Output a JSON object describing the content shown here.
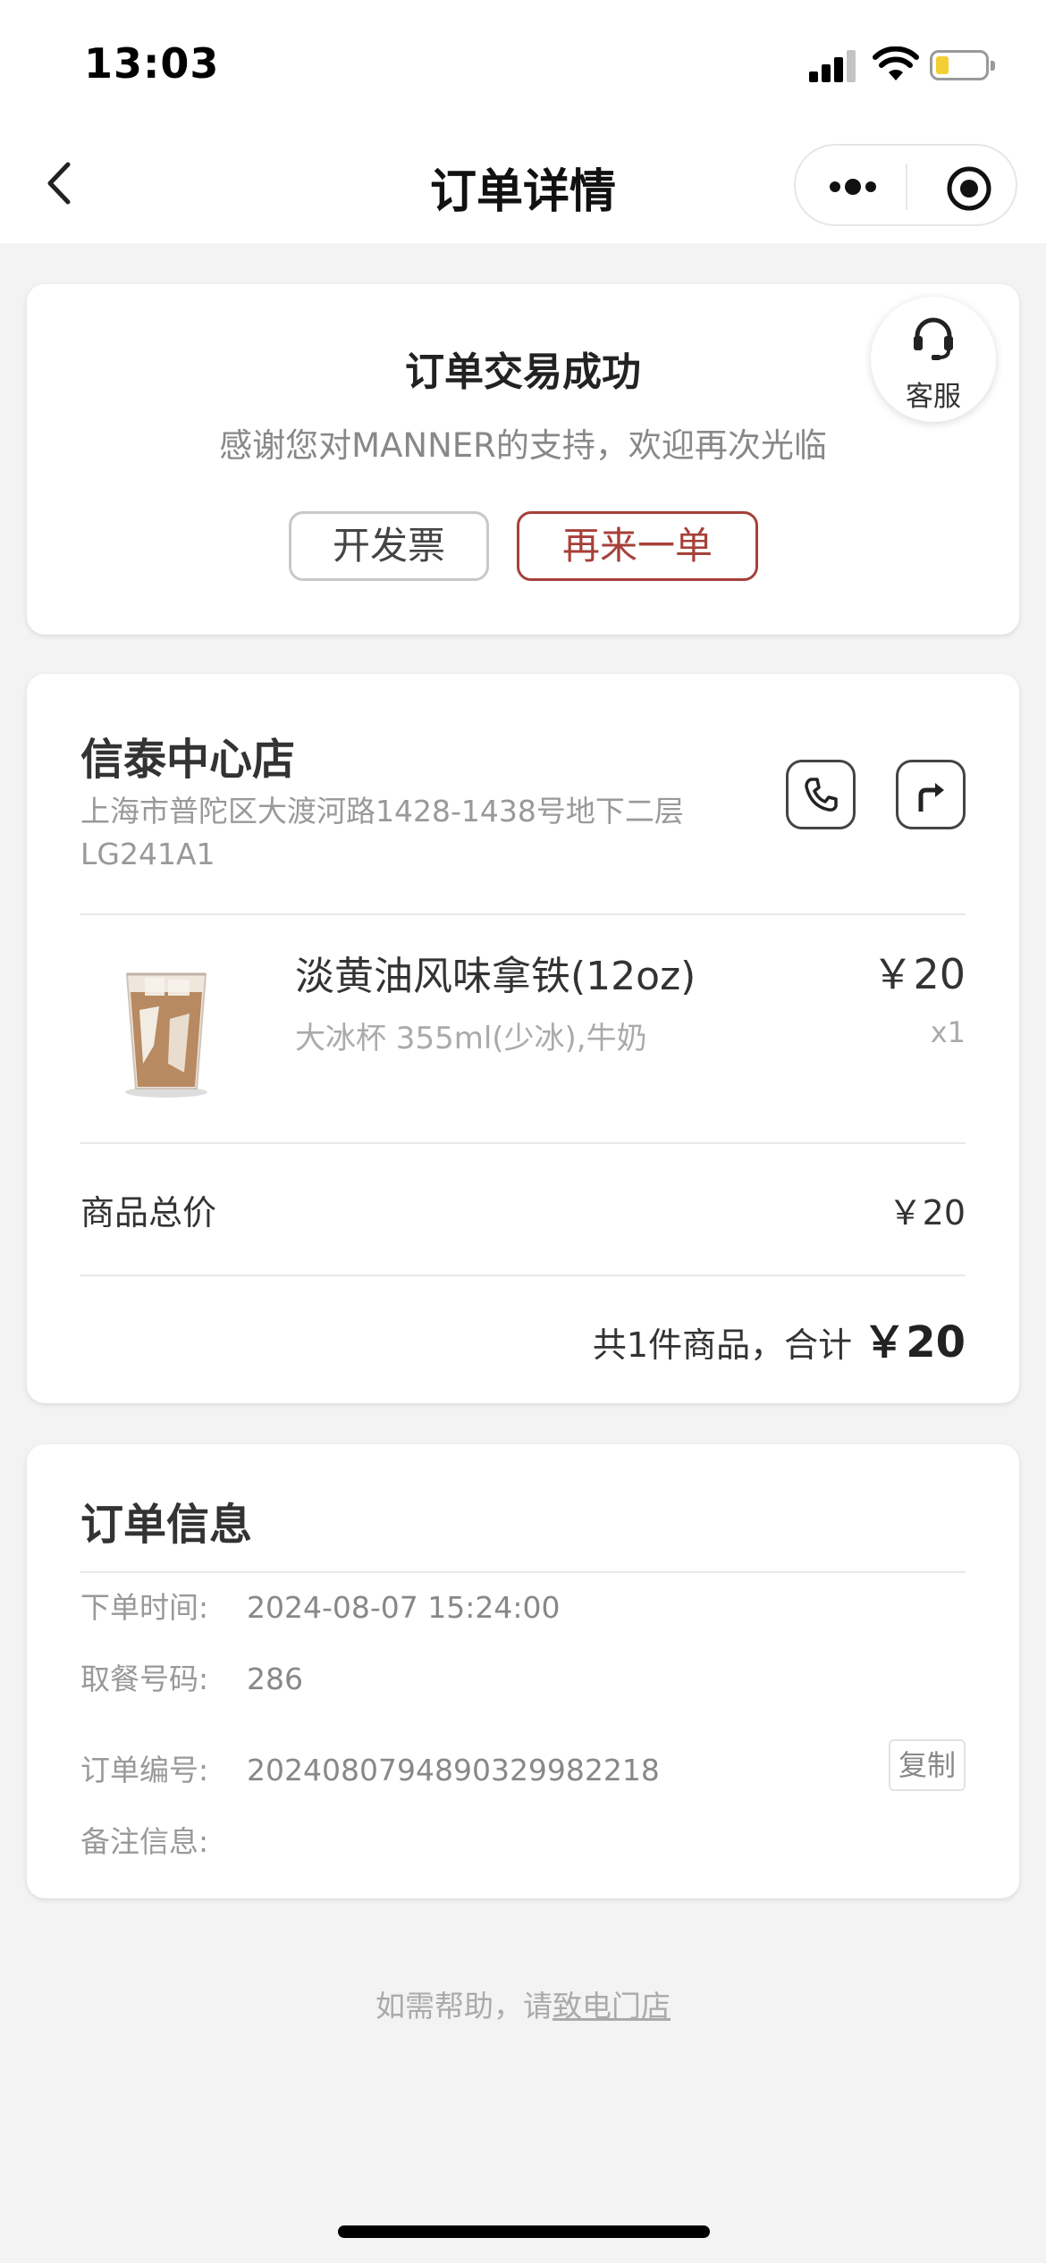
{
  "status_bar": {
    "time": "13:03"
  },
  "nav": {
    "title": "订单详情"
  },
  "status_card": {
    "title": "订单交易成功",
    "subtitle": "感谢您对MANNER的支持，欢迎再次光临",
    "invoice_label": "开发票",
    "reorder_label": "再来一单",
    "service_label": "客服"
  },
  "store": {
    "name": "信泰中心店",
    "address": "上海市普陀区大渡河路1428-1438号地下二层LG241A1"
  },
  "product": {
    "name": "淡黄油风味拿铁(12oz)",
    "spec": "大冰杯 355ml(少冰),牛奶",
    "price": "￥20",
    "qty": "x1"
  },
  "summary": {
    "subtotal_label": "商品总价",
    "subtotal_value": "￥20",
    "total_prefix": "共1件商品，合计",
    "total_amount": "￥20"
  },
  "order_info": {
    "title": "订单信息",
    "rows": [
      {
        "key": "下单时间:",
        "value": "2024-08-07 15:24:00"
      },
      {
        "key": "取餐号码:",
        "value": "286"
      },
      {
        "key": "订单编号:",
        "value": "20240807948903299822​18"
      },
      {
        "key": "备注信息:",
        "value": ""
      }
    ],
    "copy_label": "复制"
  },
  "help": {
    "prefix": "如需帮助，请",
    "link": "致电门店"
  },
  "colors": {
    "accent": "#a6403a",
    "battery": "#f4cf33",
    "background": "#f3f3f3"
  }
}
